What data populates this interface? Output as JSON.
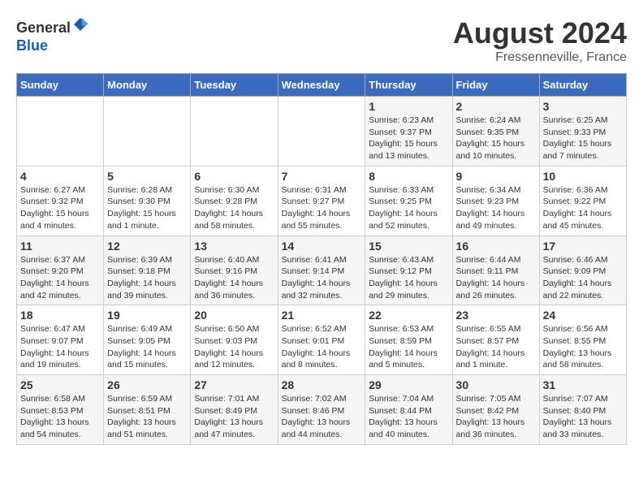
{
  "header": {
    "logo_line1": "General",
    "logo_line2": "Blue",
    "main_title": "August 2024",
    "subtitle": "Fressenneville, France"
  },
  "days_of_week": [
    "Sunday",
    "Monday",
    "Tuesday",
    "Wednesday",
    "Thursday",
    "Friday",
    "Saturday"
  ],
  "weeks": [
    [
      {
        "day": "",
        "info": ""
      },
      {
        "day": "",
        "info": ""
      },
      {
        "day": "",
        "info": ""
      },
      {
        "day": "",
        "info": ""
      },
      {
        "day": "1",
        "info": "Sunrise: 6:23 AM\nSunset: 9:37 PM\nDaylight: 15 hours and 13 minutes."
      },
      {
        "day": "2",
        "info": "Sunrise: 6:24 AM\nSunset: 9:35 PM\nDaylight: 15 hours and 10 minutes."
      },
      {
        "day": "3",
        "info": "Sunrise: 6:25 AM\nSunset: 9:33 PM\nDaylight: 15 hours and 7 minutes."
      }
    ],
    [
      {
        "day": "4",
        "info": "Sunrise: 6:27 AM\nSunset: 9:32 PM\nDaylight: 15 hours and 4 minutes."
      },
      {
        "day": "5",
        "info": "Sunrise: 6:28 AM\nSunset: 9:30 PM\nDaylight: 15 hours and 1 minute."
      },
      {
        "day": "6",
        "info": "Sunrise: 6:30 AM\nSunset: 9:28 PM\nDaylight: 14 hours and 58 minutes."
      },
      {
        "day": "7",
        "info": "Sunrise: 6:31 AM\nSunset: 9:27 PM\nDaylight: 14 hours and 55 minutes."
      },
      {
        "day": "8",
        "info": "Sunrise: 6:33 AM\nSunset: 9:25 PM\nDaylight: 14 hours and 52 minutes."
      },
      {
        "day": "9",
        "info": "Sunrise: 6:34 AM\nSunset: 9:23 PM\nDaylight: 14 hours and 49 minutes."
      },
      {
        "day": "10",
        "info": "Sunrise: 6:36 AM\nSunset: 9:22 PM\nDaylight: 14 hours and 45 minutes."
      }
    ],
    [
      {
        "day": "11",
        "info": "Sunrise: 6:37 AM\nSunset: 9:20 PM\nDaylight: 14 hours and 42 minutes."
      },
      {
        "day": "12",
        "info": "Sunrise: 6:39 AM\nSunset: 9:18 PM\nDaylight: 14 hours and 39 minutes."
      },
      {
        "day": "13",
        "info": "Sunrise: 6:40 AM\nSunset: 9:16 PM\nDaylight: 14 hours and 36 minutes."
      },
      {
        "day": "14",
        "info": "Sunrise: 6:41 AM\nSunset: 9:14 PM\nDaylight: 14 hours and 32 minutes."
      },
      {
        "day": "15",
        "info": "Sunrise: 6:43 AM\nSunset: 9:12 PM\nDaylight: 14 hours and 29 minutes."
      },
      {
        "day": "16",
        "info": "Sunrise: 6:44 AM\nSunset: 9:11 PM\nDaylight: 14 hours and 26 minutes."
      },
      {
        "day": "17",
        "info": "Sunrise: 6:46 AM\nSunset: 9:09 PM\nDaylight: 14 hours and 22 minutes."
      }
    ],
    [
      {
        "day": "18",
        "info": "Sunrise: 6:47 AM\nSunset: 9:07 PM\nDaylight: 14 hours and 19 minutes."
      },
      {
        "day": "19",
        "info": "Sunrise: 6:49 AM\nSunset: 9:05 PM\nDaylight: 14 hours and 15 minutes."
      },
      {
        "day": "20",
        "info": "Sunrise: 6:50 AM\nSunset: 9:03 PM\nDaylight: 14 hours and 12 minutes."
      },
      {
        "day": "21",
        "info": "Sunrise: 6:52 AM\nSunset: 9:01 PM\nDaylight: 14 hours and 8 minutes."
      },
      {
        "day": "22",
        "info": "Sunrise: 6:53 AM\nSunset: 8:59 PM\nDaylight: 14 hours and 5 minutes."
      },
      {
        "day": "23",
        "info": "Sunrise: 6:55 AM\nSunset: 8:57 PM\nDaylight: 14 hours and 1 minute."
      },
      {
        "day": "24",
        "info": "Sunrise: 6:56 AM\nSunset: 8:55 PM\nDaylight: 13 hours and 58 minutes."
      }
    ],
    [
      {
        "day": "25",
        "info": "Sunrise: 6:58 AM\nSunset: 8:53 PM\nDaylight: 13 hours and 54 minutes."
      },
      {
        "day": "26",
        "info": "Sunrise: 6:59 AM\nSunset: 8:51 PM\nDaylight: 13 hours and 51 minutes."
      },
      {
        "day": "27",
        "info": "Sunrise: 7:01 AM\nSunset: 8:49 PM\nDaylight: 13 hours and 47 minutes."
      },
      {
        "day": "28",
        "info": "Sunrise: 7:02 AM\nSunset: 8:46 PM\nDaylight: 13 hours and 44 minutes."
      },
      {
        "day": "29",
        "info": "Sunrise: 7:04 AM\nSunset: 8:44 PM\nDaylight: 13 hours and 40 minutes."
      },
      {
        "day": "30",
        "info": "Sunrise: 7:05 AM\nSunset: 8:42 PM\nDaylight: 13 hours and 36 minutes."
      },
      {
        "day": "31",
        "info": "Sunrise: 7:07 AM\nSunset: 8:40 PM\nDaylight: 13 hours and 33 minutes."
      }
    ]
  ]
}
